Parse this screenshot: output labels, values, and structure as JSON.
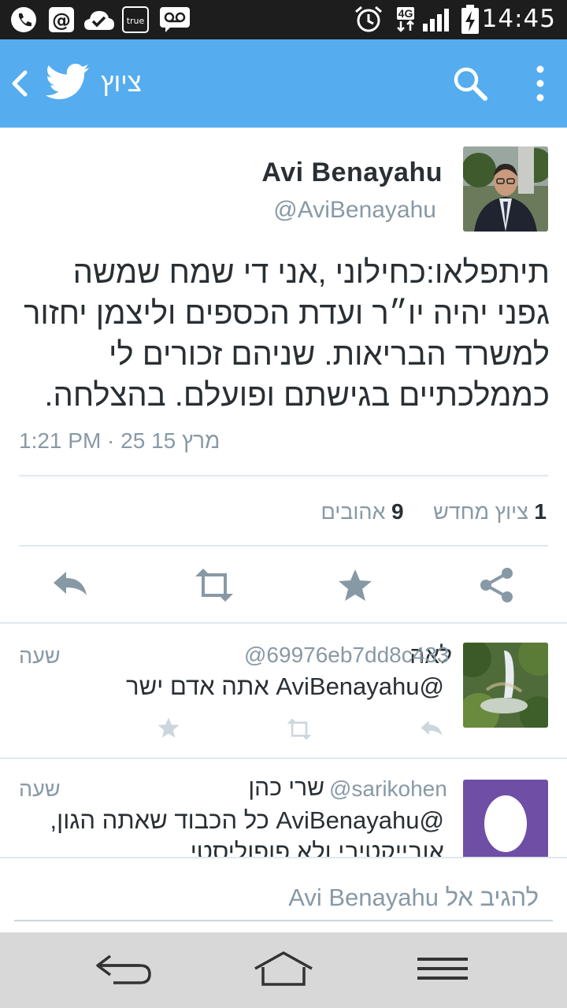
{
  "status_bar": {
    "time": "14:45",
    "network": "4G",
    "icons": [
      "phone-icon",
      "at-icon",
      "check-cloud-icon",
      "true-app-icon",
      "voicemail-icon",
      "alarm-icon",
      "signal-icon",
      "battery-charging-icon"
    ],
    "true_label": "true"
  },
  "app_bar": {
    "title": "ציוץ",
    "back_icon": "chevron-left-icon",
    "logo_icon": "twitter-bird-icon",
    "search_icon": "search-icon",
    "menu_icon": "more-vertical-icon"
  },
  "tweet": {
    "author_name": "Avi Benayahu",
    "author_handle": "@AviBenayahu",
    "text_lines": [
      "תיתפלאו:כחילוני ,אני די שמח שמשה",
      "גפני יהיה יו״ר ועדת הכספים וליצמן יחזור",
      "למשרד הבריאות. שניהם זכורים לי",
      "כממלכתיים בגישתם ופועלם. בהצלחה."
    ],
    "timestamp": "1:21 PM · 25 15 מרץ",
    "retweet_count": "1",
    "retweet_label": "ציוץ מחדש",
    "like_count": "9",
    "like_label": "אהובים"
  },
  "actions": [
    "reply-icon",
    "retweet-icon",
    "star-icon",
    "share-icon"
  ],
  "replies": [
    {
      "name": "לאה",
      "handle": "@69976eb7dd8c433",
      "time": "שעה",
      "text_lines": [
        "@AviBenayahu אתה אדם ישר"
      ]
    },
    {
      "name": "שרי כהן",
      "handle": "@sarikohen",
      "time": "שעה",
      "text_lines": [
        "@AviBenayahu כל הכבוד שאתה הגון,",
        "אובייקטיבי ולא פופוליסטי"
      ]
    }
  ],
  "compose": {
    "placeholder": "להגיב אל Avi Benayahu"
  },
  "nav_bar": [
    "back-nav-icon",
    "home-nav-icon",
    "menu-nav-icon"
  ],
  "colors": {
    "brand": "#55acee",
    "text": "#292f33",
    "muted": "#8899a6",
    "divider": "#e1e8ed",
    "egg_bg": "#6f4ea6"
  }
}
